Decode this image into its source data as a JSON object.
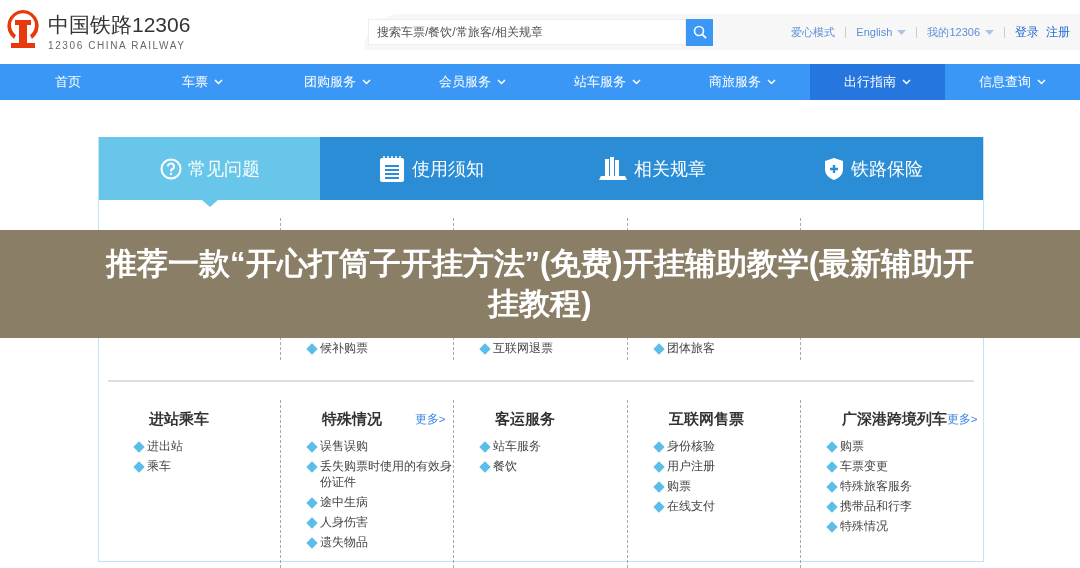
{
  "logo": {
    "title": "中国铁路12306",
    "subtitle": "12306 CHINA RAILWAY"
  },
  "search": {
    "placeholder": "搜索车票/餐饮/常旅客/相关规章"
  },
  "top_links": [
    {
      "label": "爱心模式",
      "dropdown": false
    },
    {
      "label": "English",
      "dropdown": true
    },
    {
      "label": "我的12306",
      "dropdown": true
    }
  ],
  "account_links": [
    "登录",
    "注册"
  ],
  "nav": [
    {
      "label": "首页",
      "dropdown": false,
      "selected": false
    },
    {
      "label": "车票",
      "dropdown": true,
      "selected": false
    },
    {
      "label": "团购服务",
      "dropdown": true,
      "selected": false
    },
    {
      "label": "会员服务",
      "dropdown": true,
      "selected": false
    },
    {
      "label": "站车服务",
      "dropdown": true,
      "selected": false
    },
    {
      "label": "商旅服务",
      "dropdown": true,
      "selected": false
    },
    {
      "label": "出行指南",
      "dropdown": true,
      "selected": true
    },
    {
      "label": "信息查询",
      "dropdown": true,
      "selected": false
    }
  ],
  "tabs": [
    {
      "label": "常见问题",
      "selected": true
    },
    {
      "label": "使用须知",
      "selected": false
    },
    {
      "label": "相关规章",
      "selected": false
    },
    {
      "label": "铁路保险",
      "selected": false
    }
  ],
  "upper_row": [
    {
      "items": [
        "候补购票"
      ]
    },
    {
      "items": [
        "互联网退票"
      ]
    },
    {
      "items": [
        "团体旅客"
      ]
    }
  ],
  "lower_row": [
    {
      "title": "进站乘车",
      "items": [
        "进出站",
        "乘车"
      ]
    },
    {
      "title": "特殊情况",
      "more": "更多>",
      "items": [
        "误售误购",
        "丢失购票时使用的有效身份证件",
        "途中生病",
        "人身伤害",
        "遗失物品"
      ]
    },
    {
      "title": "客运服务",
      "items": [
        "站车服务",
        "餐饮"
      ]
    },
    {
      "title": "互联网售票",
      "items": [
        "身份核验",
        "用户注册",
        "购票",
        "在线支付"
      ]
    },
    {
      "title": "广深港跨境列车",
      "more": "更多>",
      "items": [
        "购票",
        "车票变更",
        "特殊旅客服务",
        "携带品和行李",
        "特殊情况"
      ]
    }
  ],
  "overlay_caption": "推荐一款“开心打筒子开挂方法”(免费)开挂辅助教学(最新辅助开挂教程)"
}
